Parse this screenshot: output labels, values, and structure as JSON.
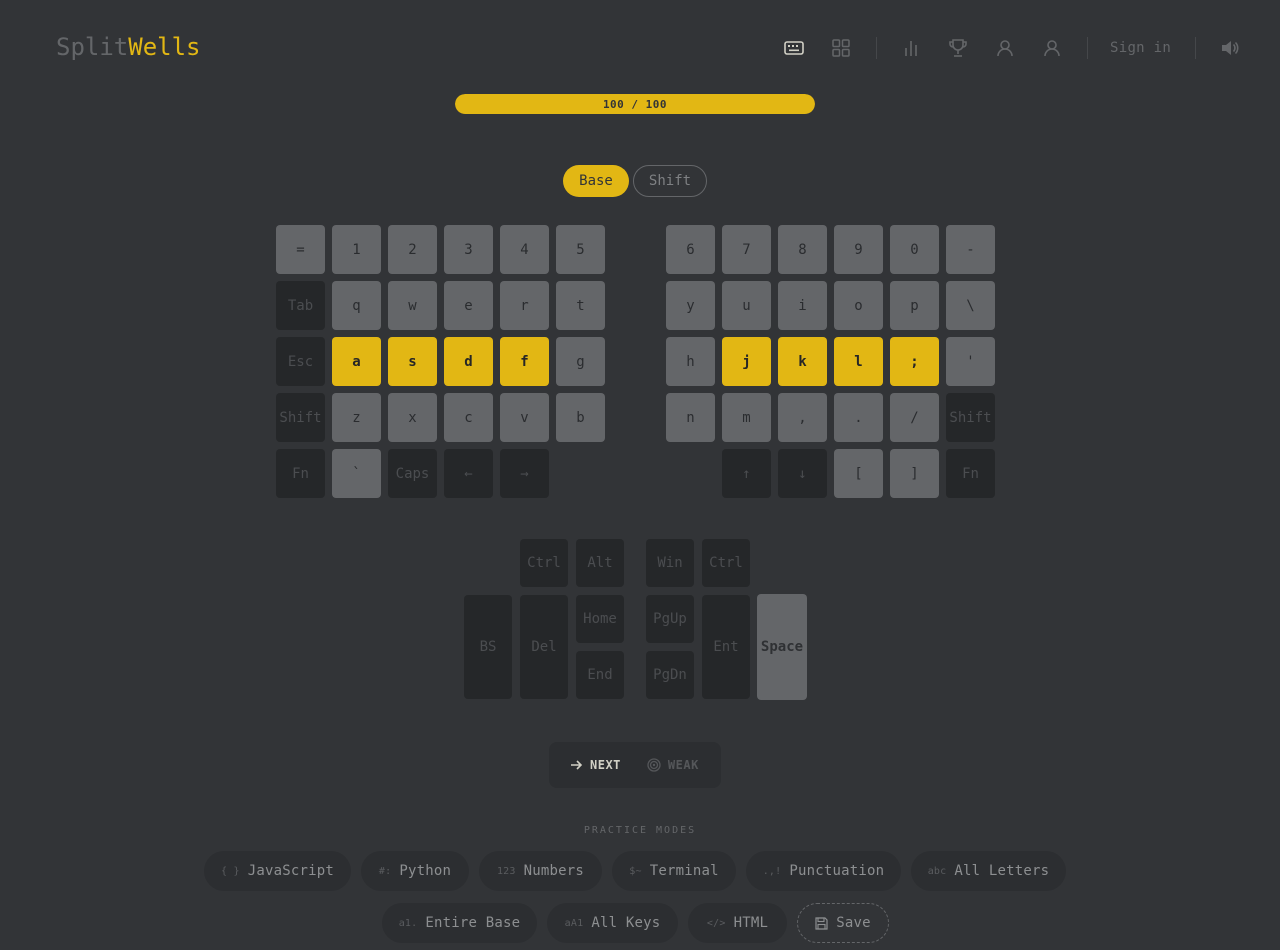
{
  "app": {
    "name_part1": "Split",
    "name_part2": "Wells"
  },
  "nav": {
    "icons": [
      "keyboard-icon",
      "grid-icon",
      "bar-chart-icon",
      "trophy-icon",
      "user-icon",
      "account-icon",
      "volume-icon"
    ],
    "sign_in": "Sign in"
  },
  "progress": {
    "label": "100 / 100",
    "value": 100,
    "max": 100
  },
  "layers": {
    "base": "Base",
    "shift": "Shift",
    "active": "Base"
  },
  "keyboard": {
    "left": [
      [
        [
          "=",
          "light"
        ],
        [
          "1",
          "light"
        ],
        [
          "2",
          "light"
        ],
        [
          "3",
          "light"
        ],
        [
          "4",
          "light"
        ],
        [
          "5",
          "light"
        ]
      ],
      [
        [
          "Tab",
          "dark"
        ],
        [
          "q",
          "light"
        ],
        [
          "w",
          "light"
        ],
        [
          "e",
          "light"
        ],
        [
          "r",
          "light"
        ],
        [
          "t",
          "light"
        ]
      ],
      [
        [
          "Esc",
          "dark"
        ],
        [
          "a",
          "home"
        ],
        [
          "s",
          "home"
        ],
        [
          "d",
          "home"
        ],
        [
          "f",
          "home"
        ],
        [
          "g",
          "light"
        ]
      ],
      [
        [
          "Shift",
          "dark"
        ],
        [
          "z",
          "light"
        ],
        [
          "x",
          "light"
        ],
        [
          "c",
          "light"
        ],
        [
          "v",
          "light"
        ],
        [
          "b",
          "light"
        ]
      ],
      [
        [
          "Fn",
          "dark"
        ],
        [
          "`",
          "light"
        ],
        [
          "Caps",
          "dark"
        ],
        [
          "←",
          "dark"
        ],
        [
          "→",
          "dark"
        ]
      ]
    ],
    "right": [
      [
        [
          "6",
          "light"
        ],
        [
          "7",
          "light"
        ],
        [
          "8",
          "light"
        ],
        [
          "9",
          "light"
        ],
        [
          "0",
          "light"
        ],
        [
          "-",
          "light"
        ]
      ],
      [
        [
          "y",
          "light"
        ],
        [
          "u",
          "light"
        ],
        [
          "i",
          "light"
        ],
        [
          "o",
          "light"
        ],
        [
          "p",
          "light"
        ],
        [
          "\\",
          "light"
        ]
      ],
      [
        [
          "h",
          "light"
        ],
        [
          "j",
          "home"
        ],
        [
          "k",
          "home"
        ],
        [
          "l",
          "home"
        ],
        [
          ";",
          "home"
        ],
        [
          "'",
          "light"
        ]
      ],
      [
        [
          "n",
          "light"
        ],
        [
          "m",
          "light"
        ],
        [
          ",",
          "light"
        ],
        [
          ".",
          "light"
        ],
        [
          "/",
          "light"
        ],
        [
          "Shift",
          "dark"
        ]
      ],
      [
        [
          "",
          "none"
        ],
        [
          "↑",
          "dark"
        ],
        [
          "↓",
          "dark"
        ],
        [
          "[",
          "light"
        ],
        [
          "]",
          "light"
        ],
        [
          "Fn",
          "dark"
        ]
      ]
    ],
    "thumb": {
      "ctrl_left": "Ctrl",
      "alt": "Alt",
      "win": "Win",
      "ctrl_right": "Ctrl",
      "bs": "BS",
      "del": "Del",
      "home": "Home",
      "end": "End",
      "pgup": "PgUp",
      "pgdn": "PgDn",
      "ent": "Ent",
      "space": "Space"
    }
  },
  "actions": {
    "next": "NEXT",
    "weak": "WEAK"
  },
  "modes": {
    "title": "PRACTICE MODES",
    "row1": [
      {
        "icon": "{ }",
        "label": "JavaScript"
      },
      {
        "icon": "#:",
        "label": "Python"
      },
      {
        "icon": "123",
        "label": "Numbers"
      },
      {
        "icon": "$~",
        "label": "Terminal"
      },
      {
        "icon": ".,!",
        "label": "Punctuation"
      },
      {
        "icon": "abc",
        "label": "All Letters"
      }
    ],
    "row2": [
      {
        "icon": "a1.",
        "label": "Entire Base"
      },
      {
        "icon": "aA1",
        "label": "All Keys"
      },
      {
        "icon": "</>",
        "label": "HTML"
      }
    ],
    "save": "Save"
  },
  "colors": {
    "accent": "#e2b714",
    "background": "#323437",
    "key_light": "#646669",
    "key_dark": "#252729"
  }
}
